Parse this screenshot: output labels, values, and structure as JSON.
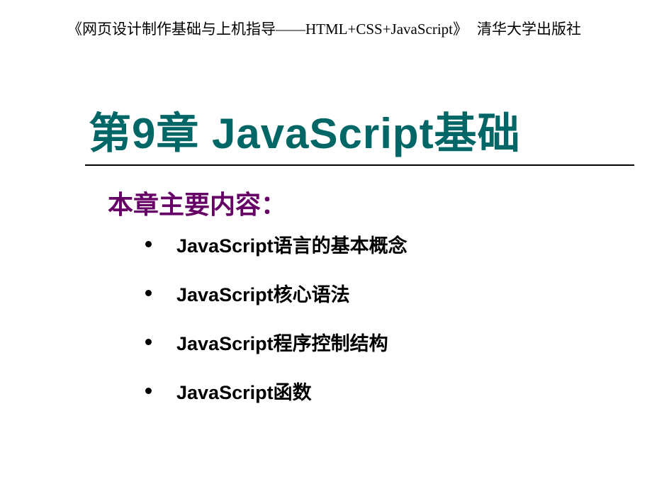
{
  "header": {
    "book_title": "《网页设计制作基础与上机指导——HTML+CSS+JavaScript》",
    "publisher": "清华大学出版社"
  },
  "main_title": "第9章 JavaScript基础",
  "sub_heading": "本章主要内容：",
  "bullets": {
    "item0": "JavaScript语言的基本概念",
    "item1": "JavaScript核心语法",
    "item2": "JavaScript程序控制结构",
    "item3": "JavaScript函数"
  }
}
